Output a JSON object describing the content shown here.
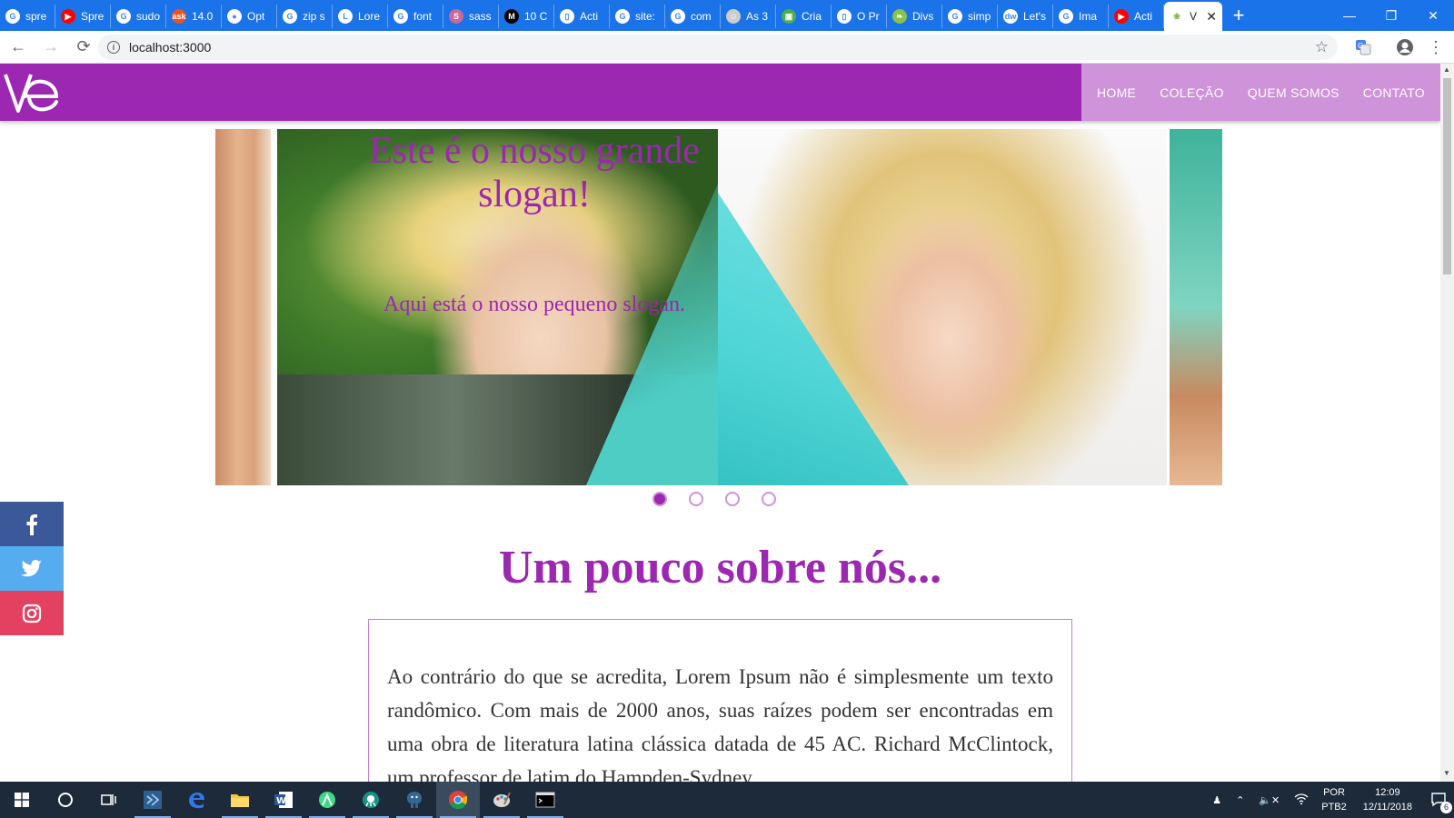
{
  "browser": {
    "tabs": [
      {
        "title": "spre",
        "icon": "google-icon",
        "color": "#ffffff"
      },
      {
        "title": "Spre",
        "icon": "youtube-icon",
        "color": "#ff0000"
      },
      {
        "title": "sudo",
        "icon": "google-icon",
        "color": "#ffffff"
      },
      {
        "title": "14.0",
        "icon": "askubuntu-icon",
        "color": "#e95420"
      },
      {
        "title": "Opt",
        "icon": "github-icon",
        "color": "#ffffff"
      },
      {
        "title": "zip s",
        "icon": "google-icon",
        "color": "#ffffff"
      },
      {
        "title": "Lore",
        "icon": "lorem-icon",
        "color": "#ffffff"
      },
      {
        "title": "font",
        "icon": "google-icon",
        "color": "#ffffff"
      },
      {
        "title": "sass",
        "icon": "sass-icon",
        "color": "#cd6799"
      },
      {
        "title": "10 C",
        "icon": "medium-icon",
        "color": "#000000"
      },
      {
        "title": "Acti",
        "icon": "page-icon",
        "color": "#ffffff"
      },
      {
        "title": "site:",
        "icon": "google-icon",
        "color": "#ffffff"
      },
      {
        "title": "com",
        "icon": "google-icon",
        "color": "#ffffff"
      },
      {
        "title": "As 3",
        "icon": "avatar-icon",
        "color": "#cccccc"
      },
      {
        "title": "Cria",
        "icon": "book-icon",
        "color": "#4caf50"
      },
      {
        "title": "O Pr",
        "icon": "page-icon",
        "color": "#ffffff"
      },
      {
        "title": "Divs",
        "icon": "leaf-icon",
        "color": "#8bc34a"
      },
      {
        "title": "simp",
        "icon": "google-icon",
        "color": "#ffffff"
      },
      {
        "title": "Let's",
        "icon": "dw-icon",
        "color": "#ffffff"
      },
      {
        "title": "Ima",
        "icon": "google-icon",
        "color": "#ffffff"
      },
      {
        "title": "Acti",
        "icon": "youtube-icon",
        "color": "#ff0000"
      }
    ],
    "active_tab": {
      "title": "V",
      "icon": "plant-icon"
    },
    "url": "localhost:3000"
  },
  "site": {
    "nav": [
      "HOME",
      "COLEÇÃO",
      "QUEM SOMOS",
      "CONTATO"
    ],
    "slogan": "Este é o nosso grande slogan!",
    "subslogan": "Aqui está o nosso pequeno slogan.",
    "slide_count": 4,
    "active_slide": 0,
    "about_title": "Um pouco sobre nós...",
    "about_text": "Ao contrário do que se acredita, Lorem Ipsum não é simplesmente um texto randômico. Com mais de 2000 anos, suas raízes podem ser encontradas em uma obra de literatura latina clássica datada de 45 AC. Richard McClintock, um professor de latim do Hampden-Sydney",
    "social": [
      "facebook-icon",
      "twitter-icon",
      "instagram-icon"
    ],
    "colors": {
      "primary": "#9c27b0",
      "nav_bg": "#ce93d8",
      "facebook": "#3b5998",
      "twitter": "#55acee",
      "instagram": "#e4405f"
    }
  },
  "taskbar": {
    "apps": [
      "start-icon",
      "cortana-icon",
      "task-view-icon",
      "visual-studio-icon",
      "edge-icon",
      "file-explorer-icon",
      "word-icon",
      "android-studio-icon",
      "gitkraken-icon",
      "postgresql-icon",
      "chrome-icon",
      "paint-icon",
      "terminal-icon"
    ],
    "language": "POR",
    "layout": "PTB2",
    "time": "12:09",
    "date": "12/11/2018",
    "notifications": "6"
  }
}
